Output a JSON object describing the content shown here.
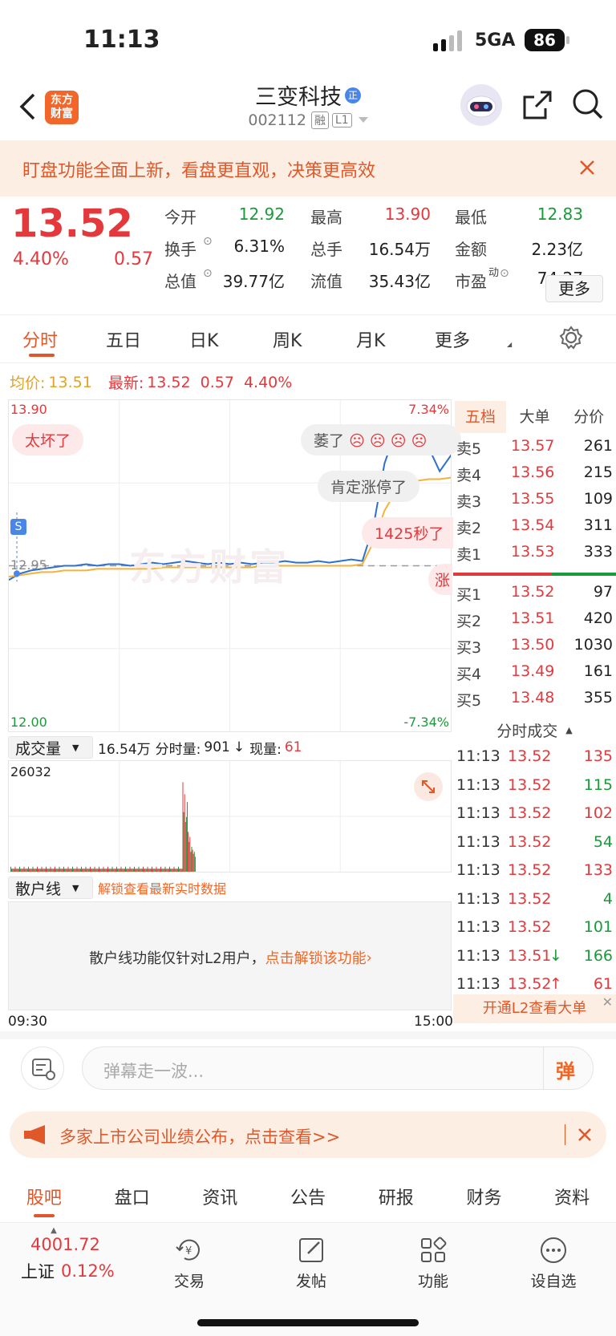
{
  "status_bar": {
    "time": "11:13",
    "network": "5GA",
    "battery": "86"
  },
  "header": {
    "stock_name": "三变科技",
    "name_badge": "正",
    "stock_code": "002112",
    "code_tag1": "融",
    "code_tag2": "L1",
    "app_logo_text": "东方财富"
  },
  "notice": {
    "text": "盯盘功能全面上新，看盘更直观，决策更高效"
  },
  "quote": {
    "price": "13.52",
    "change_pct": "4.40%",
    "change": "0.57",
    "rows": [
      [
        {
          "label": "今开",
          "value": "12.92",
          "color": "green"
        },
        {
          "label": "最高",
          "value": "13.90",
          "color": "red"
        },
        {
          "label": "最低",
          "value": "12.83",
          "color": "green"
        }
      ],
      [
        {
          "label": "换手",
          "value": "6.31%",
          "color": "dark"
        },
        {
          "label": "总手",
          "value": "16.54万",
          "color": "dark"
        },
        {
          "label": "金额",
          "value": "2.23亿",
          "color": "dark"
        }
      ],
      [
        {
          "label": "总值",
          "value": "39.77亿",
          "color": "dark"
        },
        {
          "label": "流值",
          "value": "35.43亿",
          "color": "dark"
        },
        {
          "label": "市盈",
          "value": "74.27",
          "color": "dark"
        }
      ]
    ],
    "pe_sup": "动",
    "more_button": "更多"
  },
  "chart_tabs": [
    "分时",
    "五日",
    "日K",
    "周K",
    "月K",
    "更多"
  ],
  "avg_line": {
    "avg_label": "均价:",
    "avg_value": "13.51",
    "last_label": "最新:",
    "last_value": "13.52",
    "change": "0.57",
    "change_pct": "4.40%"
  },
  "chart_data": {
    "type": "line",
    "ylim": [
      12.0,
      13.9
    ],
    "y_top_label": "13.90",
    "y_bottom_label": "12.00",
    "y_mid_label": "12.95",
    "pct_top": "7.34%",
    "pct_bottom": "-7.34%",
    "x_start": "09:30",
    "x_end": "15:00",
    "watermark": "东方财富",
    "series": [
      {
        "color": "#2f6fd0",
        "values": [
          12.86,
          12.9,
          12.92,
          12.93,
          12.94,
          12.95,
          12.95,
          12.96,
          12.95,
          12.96,
          12.96,
          12.95,
          12.96,
          12.97,
          12.96,
          12.97,
          12.98,
          12.97,
          12.96,
          12.97,
          12.96,
          12.97,
          12.96,
          12.97,
          12.97,
          12.98,
          12.97,
          12.97,
          12.98,
          12.97,
          12.98,
          12.99,
          12.98,
          13.2,
          13.6,
          13.8,
          13.76,
          13.84,
          13.7,
          13.55,
          13.65,
          13.52
        ]
      },
      {
        "color": "#f3b23a",
        "values": [
          12.88,
          12.89,
          12.9,
          12.91,
          12.91,
          12.92,
          12.92,
          12.92,
          12.93,
          12.93,
          12.93,
          12.93,
          12.93,
          12.93,
          12.94,
          12.94,
          12.94,
          12.94,
          12.94,
          12.94,
          12.94,
          12.94,
          12.94,
          12.95,
          12.95,
          12.95,
          12.95,
          12.95,
          12.95,
          12.95,
          12.95,
          12.95,
          12.96,
          13.1,
          13.3,
          13.42,
          13.47,
          13.49,
          13.5,
          13.5,
          13.51,
          13.51
        ]
      }
    ],
    "volume_max_label": "26032"
  },
  "danmaku": [
    "太坏了",
    "萎了",
    "肯定涨停了",
    "1425秒了",
    "涨"
  ],
  "order_book": {
    "tabs": [
      "五档",
      "大单",
      "分价"
    ],
    "asks": [
      {
        "label": "卖5",
        "price": "13.57",
        "vol": "261"
      },
      {
        "label": "卖4",
        "price": "13.56",
        "vol": "215"
      },
      {
        "label": "卖3",
        "price": "13.55",
        "vol": "109"
      },
      {
        "label": "卖2",
        "price": "13.54",
        "vol": "311"
      },
      {
        "label": "卖1",
        "price": "13.53",
        "vol": "333"
      }
    ],
    "bids": [
      {
        "label": "买1",
        "price": "13.52",
        "vol": "97"
      },
      {
        "label": "买2",
        "price": "13.51",
        "vol": "420"
      },
      {
        "label": "买3",
        "price": "13.50",
        "vol": "1030"
      },
      {
        "label": "买4",
        "price": "13.49",
        "vol": "161"
      },
      {
        "label": "买5",
        "price": "13.48",
        "vol": "355"
      }
    ],
    "trades_title": "分时成交",
    "trades": [
      {
        "time": "11:13",
        "price": "13.52",
        "vol": "135",
        "dir": "red",
        "arrow": ""
      },
      {
        "time": "11:13",
        "price": "13.52",
        "vol": "115",
        "dir": "green",
        "arrow": ""
      },
      {
        "time": "11:13",
        "price": "13.52",
        "vol": "102",
        "dir": "red",
        "arrow": ""
      },
      {
        "time": "11:13",
        "price": "13.52",
        "vol": "54",
        "dir": "green",
        "arrow": ""
      },
      {
        "time": "11:13",
        "price": "13.52",
        "vol": "133",
        "dir": "red",
        "arrow": ""
      },
      {
        "time": "11:13",
        "price": "13.52",
        "vol": "4",
        "dir": "green",
        "arrow": ""
      },
      {
        "time": "11:13",
        "price": "13.52",
        "vol": "101",
        "dir": "green",
        "arrow": ""
      },
      {
        "time": "11:13",
        "price": "13.51",
        "vol": "166",
        "dir": "green",
        "arrow": "↓"
      },
      {
        "time": "11:13",
        "price": "13.52",
        "vol": "61",
        "dir": "red",
        "arrow": "↑"
      }
    ],
    "l2_banner": "开通L2查看大单"
  },
  "volume_bar": {
    "select": "成交量",
    "total": "16.54万",
    "minute_label": "分时量:",
    "minute_value": "901",
    "arrow": "↓",
    "now_label": "现量:",
    "now_value": "61"
  },
  "retail_bar": {
    "select": "散户线",
    "unlock_link": "解锁查看最新实时数据",
    "msg": "散户线功能仅针对L2用户，",
    "msg_link": "点击解锁该功能"
  },
  "comment": {
    "placeholder": "弹幕走一波...",
    "send_label": "弹"
  },
  "promo": {
    "text": "多家上市公司业绩公布，点击查看>>"
  },
  "bottom_tabs": [
    "股吧",
    "盘口",
    "资讯",
    "公告",
    "研报",
    "财务",
    "资料"
  ],
  "toolbar": {
    "index_value": "4001.72",
    "index_name": "上证",
    "index_change": "0.12%",
    "items": [
      "交易",
      "发帖",
      "功能",
      "设自选"
    ]
  }
}
